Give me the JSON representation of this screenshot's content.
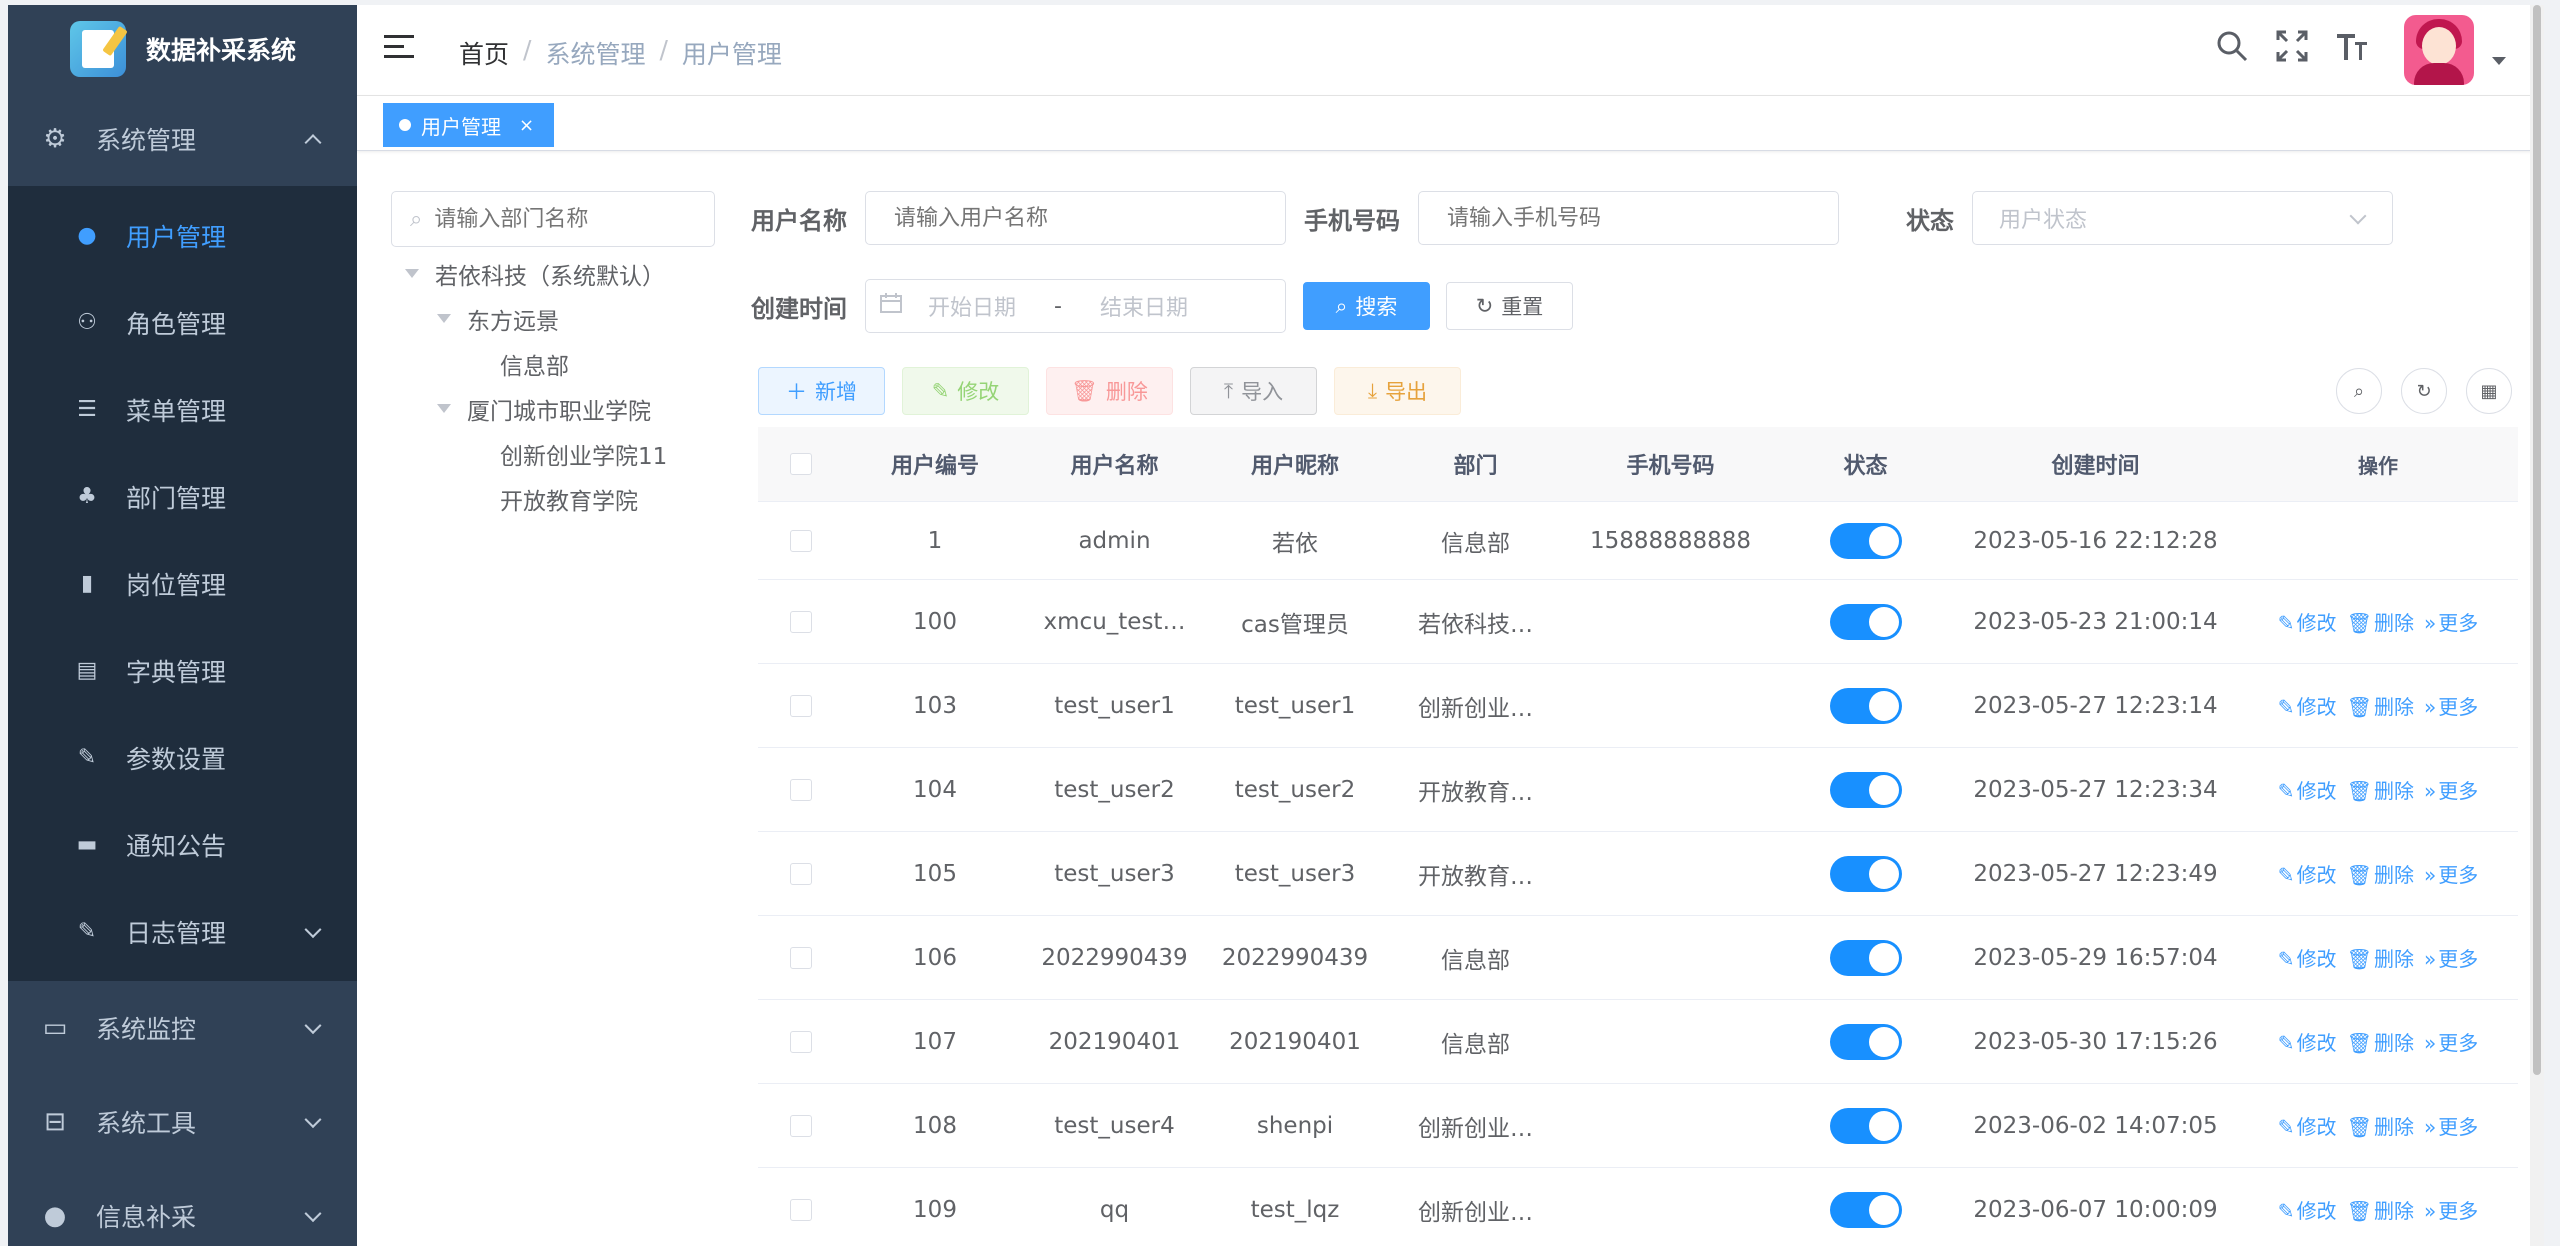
{
  "app": {
    "title": "数据补采系统"
  },
  "sidebar": {
    "groups": [
      {
        "label": "系统管理",
        "icon": "gear-icon",
        "expanded": true
      },
      {
        "label": "系统监控",
        "icon": "monitor-icon",
        "expanded": false
      },
      {
        "label": "系统工具",
        "icon": "toolbox-icon",
        "expanded": false
      },
      {
        "label": "信息补采",
        "icon": "user-icon",
        "expanded": false
      }
    ],
    "items": [
      {
        "label": "用户管理",
        "icon": "user-icon",
        "active": true
      },
      {
        "label": "角色管理",
        "icon": "people-icon"
      },
      {
        "label": "菜单管理",
        "icon": "list-icon"
      },
      {
        "label": "部门管理",
        "icon": "tree-icon"
      },
      {
        "label": "岗位管理",
        "icon": "badge-icon"
      },
      {
        "label": "字典管理",
        "icon": "book-icon"
      },
      {
        "label": "参数设置",
        "icon": "edit-icon"
      },
      {
        "label": "通知公告",
        "icon": "message-icon"
      },
      {
        "label": "日志管理",
        "icon": "log-icon"
      }
    ]
  },
  "breadcrumb": {
    "home": "首页",
    "sep": "/",
    "level1": "系统管理",
    "level2": "用户管理"
  },
  "tags": {
    "active": "用户管理",
    "close": "×"
  },
  "dept": {
    "search_placeholder": "请输入部门名称",
    "tree": {
      "root": "若依科技（系统默认）",
      "n1": "东方远景",
      "n1_1": "信息部",
      "n2": "厦门城市职业学院",
      "n2_1": "创新创业学院11",
      "n2_2": "开放教育学院"
    }
  },
  "form": {
    "username_label": "用户名称",
    "username_placeholder": "请输入用户名称",
    "phone_label": "手机号码",
    "phone_placeholder": "请输入手机号码",
    "status_label": "状态",
    "status_placeholder": "用户状态",
    "created_label": "创建时间",
    "start_placeholder": "开始日期",
    "range_sep": "-",
    "end_placeholder": "结束日期",
    "search_btn": "搜索",
    "reset_btn": "重置"
  },
  "toolbar": {
    "add": "新增",
    "edit": "修改",
    "delete": "删除",
    "import": "导入",
    "export": "导出"
  },
  "table": {
    "headers": {
      "id": "用户编号",
      "name": "用户名称",
      "nick": "用户昵称",
      "dept": "部门",
      "phone": "手机号码",
      "status": "状态",
      "created": "创建时间",
      "ops": "操作"
    },
    "op_labels": {
      "edit": "修改",
      "delete": "删除",
      "more": "更多"
    },
    "rows": [
      {
        "id": "1",
        "name": "admin",
        "nick": "若依",
        "dept": "信息部",
        "phone": "15888888888",
        "status_on": true,
        "created": "2023-05-16 22:12:28"
      },
      {
        "id": "100",
        "name": "xmcu_test…",
        "nick": "cas管理员",
        "dept": "若依科技…",
        "phone": "",
        "status_on": true,
        "created": "2023-05-23 21:00:14"
      },
      {
        "id": "103",
        "name": "test_user1",
        "nick": "test_user1",
        "dept": "创新创业…",
        "phone": "",
        "status_on": true,
        "created": "2023-05-27 12:23:14"
      },
      {
        "id": "104",
        "name": "test_user2",
        "nick": "test_user2",
        "dept": "开放教育…",
        "phone": "",
        "status_on": true,
        "created": "2023-05-27 12:23:34"
      },
      {
        "id": "105",
        "name": "test_user3",
        "nick": "test_user3",
        "dept": "开放教育…",
        "phone": "",
        "status_on": true,
        "created": "2023-05-27 12:23:49"
      },
      {
        "id": "106",
        "name": "2022990439",
        "nick": "2022990439",
        "dept": "信息部",
        "phone": "",
        "status_on": true,
        "created": "2023-05-29 16:57:04"
      },
      {
        "id": "107",
        "name": "202190401",
        "nick": "202190401",
        "dept": "信息部",
        "phone": "",
        "status_on": true,
        "created": "2023-05-30 17:15:26"
      },
      {
        "id": "108",
        "name": "test_user4",
        "nick": "shenpi",
        "dept": "创新创业…",
        "phone": "",
        "status_on": true,
        "created": "2023-06-02 14:07:05"
      },
      {
        "id": "109",
        "name": "qq",
        "nick": "test_lqz",
        "dept": "创新创业…",
        "phone": "",
        "status_on": true,
        "created": "2023-06-07 10:00:09"
      }
    ]
  },
  "colors": {
    "sidebar_bg": "#304156",
    "submenu_bg": "#1f2d3d",
    "accent": "#409eff",
    "switch_on": "#1890ff"
  }
}
